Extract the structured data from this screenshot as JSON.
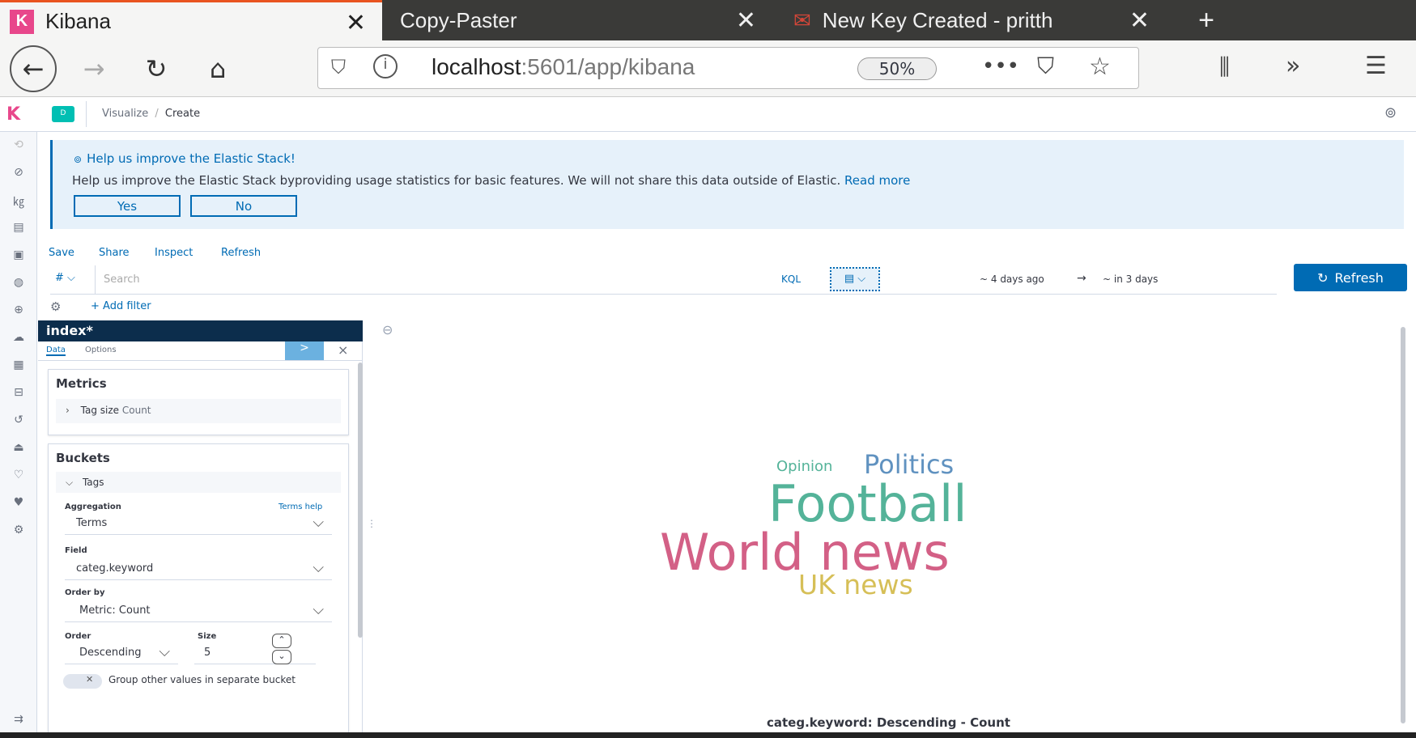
{
  "browser": {
    "tabs": [
      {
        "title": "Kibana",
        "icon": "kibana-logo-icon",
        "active": true
      },
      {
        "title": "Copy-Paster",
        "active": false
      },
      {
        "title": "New Key Created - pritth",
        "icon": "gmail-icon",
        "active": false
      }
    ],
    "new_tab": "+",
    "url_host": "localhost",
    "url_path": ":5601/app/kibana",
    "zoom": "50%"
  },
  "kibana": {
    "breadcrumb": {
      "parent": "Visualize",
      "sep": "/",
      "current": "Create"
    },
    "space_badge": "D",
    "callout": {
      "title": "Help us improve the Elastic Stack!",
      "body": "Help us improve the Elastic Stack byproviding usage statistics for basic features. We will not share this data outside of Elastic.",
      "link": "Read more",
      "yes": "Yes",
      "no": "No"
    },
    "top_nav": {
      "save": "Save",
      "share": "Share",
      "inspect": "Inspect",
      "refresh": "Refresh"
    },
    "query": {
      "placeholder": "Search",
      "lang": "KQL",
      "time_from": "~ 4 days ago",
      "arrow": "→",
      "time_to": "~ in 3 days",
      "refresh_button": "Refresh",
      "add_filter": "+ Add filter",
      "field_prefix": "#"
    },
    "editor": {
      "index": "index*",
      "tabs": [
        "Data",
        "Options"
      ],
      "apply": ">",
      "close": "×",
      "metrics": {
        "title": "Metrics",
        "item": "Tag size",
        "item_value": "Count"
      },
      "buckets": {
        "title": "Buckets",
        "group": "Tags",
        "aggregation_label": "Aggregation",
        "help_link": "Terms help",
        "aggregation": "Terms",
        "field_label": "Field",
        "field": "categ.keyword",
        "orderby_label": "Order by",
        "orderby": "Metric: Count",
        "order_label": "Order",
        "order": "Descending",
        "size_label": "Size",
        "size": "5",
        "group_other": "Group other values in separate bucket"
      }
    },
    "viz": {
      "words": [
        {
          "text": "World news",
          "color": "#d36086"
        },
        {
          "text": "Football",
          "color": "#54b399"
        },
        {
          "text": "Politics",
          "color": "#6092c0"
        },
        {
          "text": "UK news",
          "color": "#d6bf57"
        },
        {
          "text": "Opinion",
          "color": "#54b399"
        }
      ],
      "caption": "categ.keyword: Descending - Count"
    }
  },
  "colors": {
    "accent": "#006bb4",
    "header": "#0c2d4c"
  }
}
